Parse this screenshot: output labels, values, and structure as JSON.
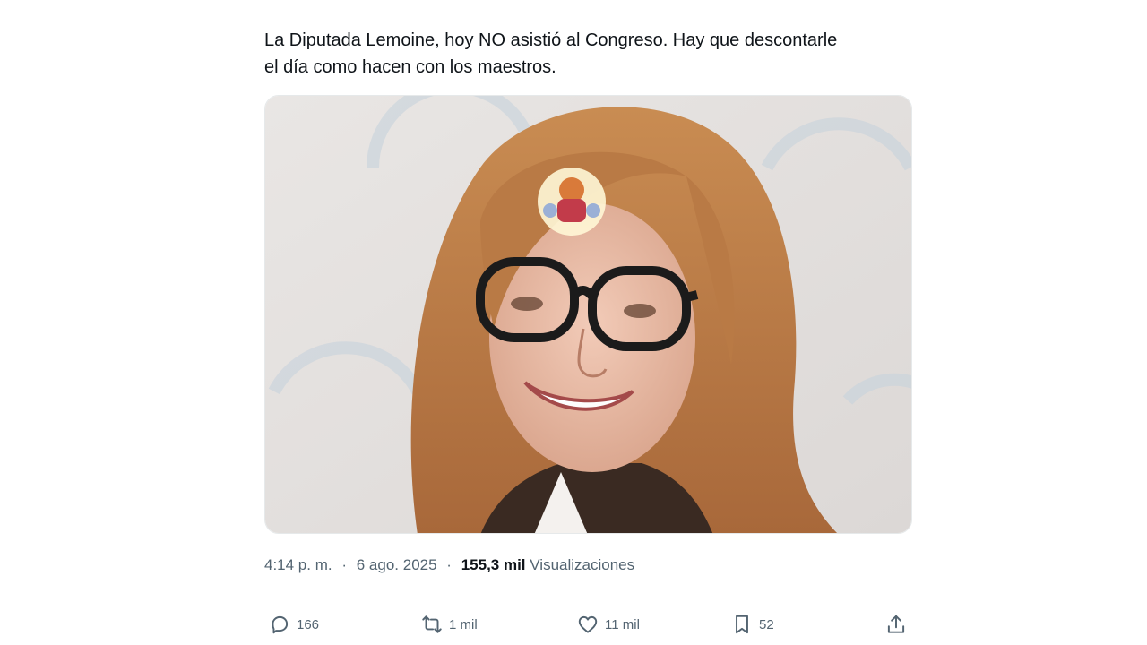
{
  "tweet": {
    "text_lines": [
      "La Diputada Lemoine, hoy NO asistió al Congreso. Hay que descontarle",
      "el día como hacen con los maestros."
    ],
    "media_icon": "photo",
    "time": "4:14 p. m.",
    "separator": "·",
    "date": "6 ago. 2025",
    "views_count": "155,3 mil",
    "views_label": "Visualizaciones"
  },
  "actions": {
    "reply": {
      "icon": "reply-icon",
      "count": "166"
    },
    "retweet": {
      "icon": "retweet-icon",
      "count": "1 mil"
    },
    "like": {
      "icon": "heart-icon",
      "count": "11 mil"
    },
    "bookmark": {
      "icon": "bookmark-icon",
      "count": "52"
    },
    "share": {
      "icon": "share-icon"
    }
  },
  "colors": {
    "text": "#0f1419",
    "secondary": "#536471",
    "divider": "#eff3f4"
  }
}
